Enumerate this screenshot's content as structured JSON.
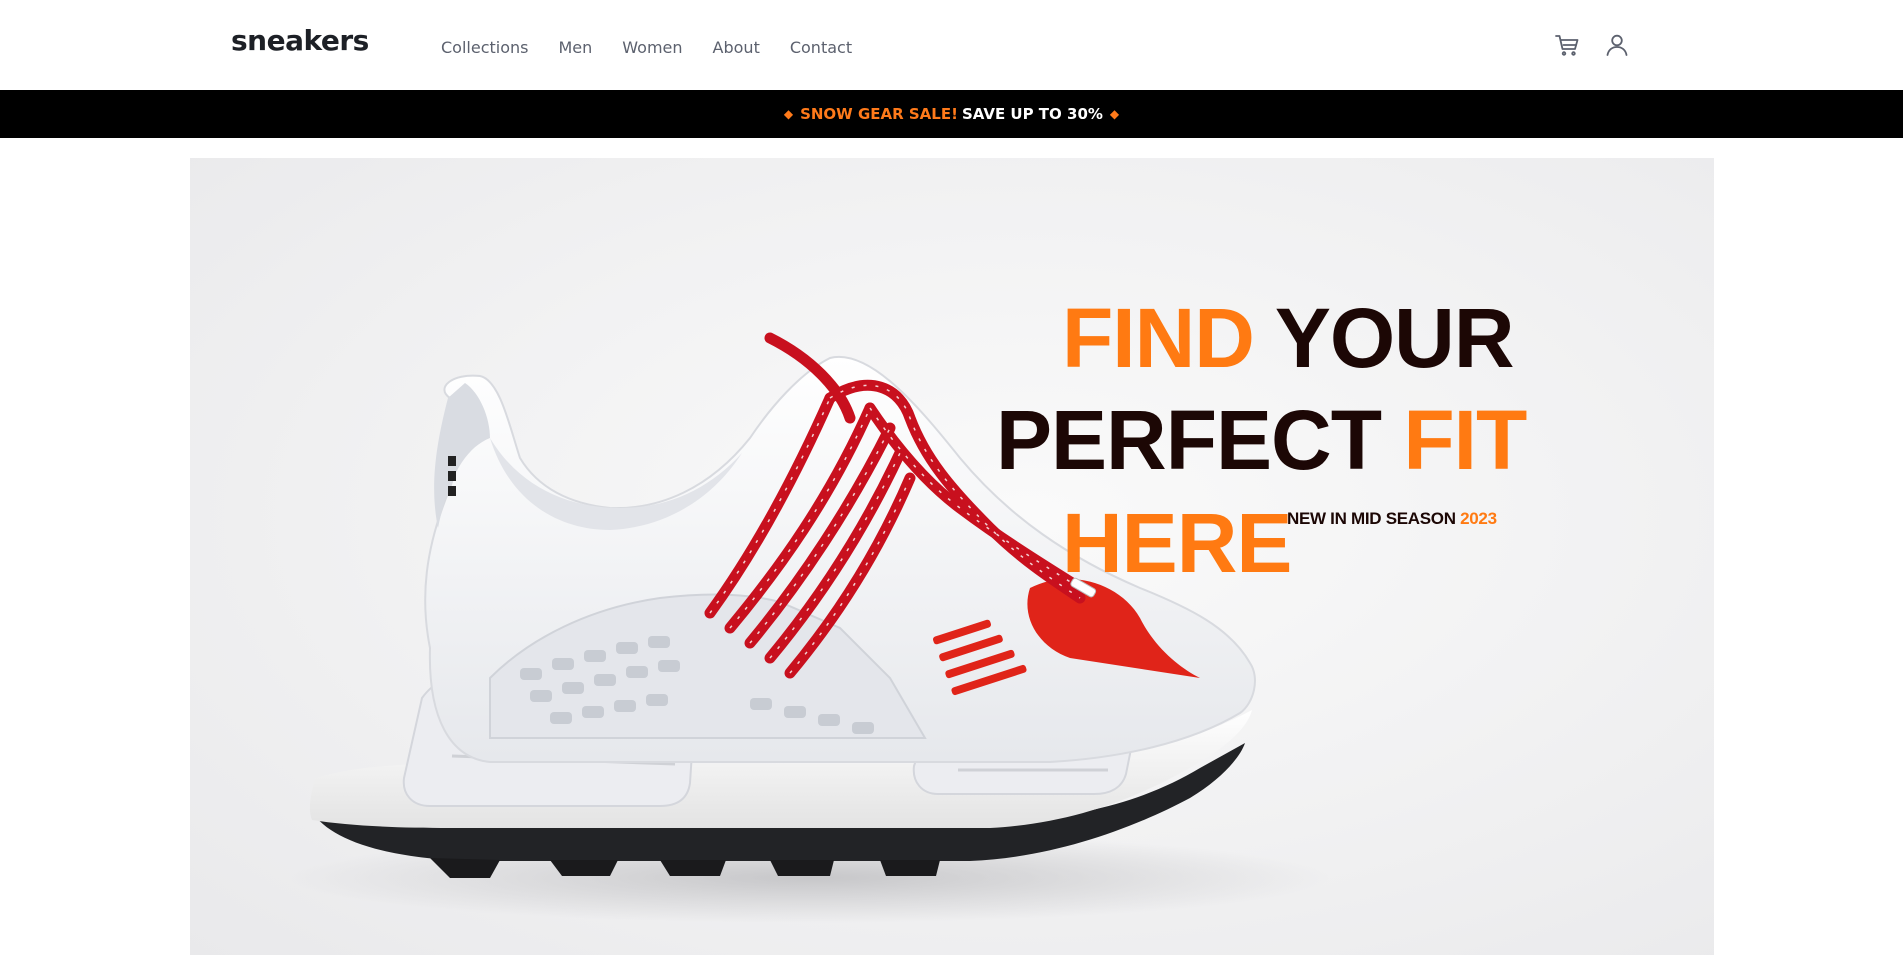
{
  "header": {
    "logo": "sneakers",
    "nav": [
      "Collections",
      "Men",
      "Women",
      "About",
      "Contact"
    ],
    "icons": [
      "cart-icon",
      "user-icon"
    ]
  },
  "promo": {
    "sale_text": "SNOW GEAR SALE!",
    "save_text": "SAVE UP TO 30%",
    "diamond": "◆"
  },
  "hero": {
    "line1_orange": "FIND",
    "line1_dark": "YOUR",
    "line2_dark": "PERFECT",
    "line2_orange": "FIT",
    "line3_orange": "HERE",
    "season_text": "NEW IN MID SEASON",
    "season_year": "2023"
  },
  "colors": {
    "accent": "#ff7a12",
    "dark_text": "#1c0705",
    "nav_text": "#5c616e",
    "banner_bg": "#000000",
    "lace_red": "#c8101e"
  }
}
